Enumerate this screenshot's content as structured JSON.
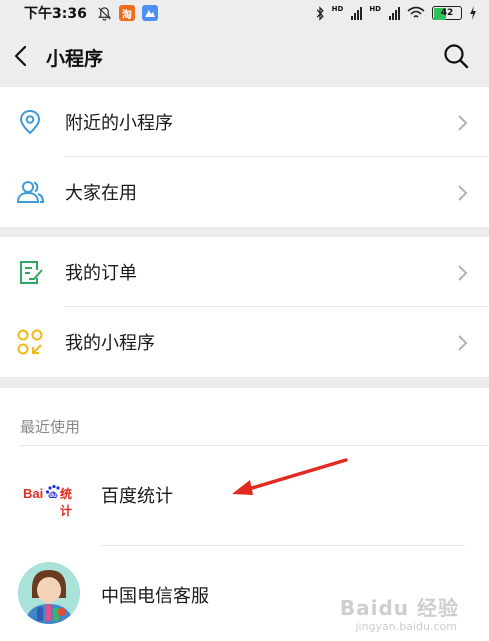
{
  "status_bar": {
    "time": "下午3:36",
    "signal_label_1": "HD",
    "signal_label_2": "HD",
    "battery_level": "42"
  },
  "nav": {
    "title": "小程序",
    "back_icon": "chevron-left-icon",
    "search_icon": "search-icon"
  },
  "menu_groups": [
    {
      "items": [
        {
          "label": "附近的小程序",
          "icon": "location-pin-icon"
        },
        {
          "label": "大家在用",
          "icon": "users-icon"
        }
      ]
    },
    {
      "items": [
        {
          "label": "我的订单",
          "icon": "order-list-icon"
        },
        {
          "label": "我的小程序",
          "icon": "my-apps-icon"
        }
      ]
    }
  ],
  "recent": {
    "title": "最近使用",
    "apps": [
      {
        "name": "百度统计",
        "logo_text": "统计"
      },
      {
        "name": "中国电信客服"
      }
    ]
  },
  "colors": {
    "accent_green": "#07c160",
    "icon_blue": "#3e9bd8",
    "icon_yellow": "#f4b916",
    "baidu_red": "#e02a22",
    "baidu_blue": "#2932e1",
    "arrow_red": "#e32a20"
  },
  "watermark": {
    "text": "Baidu 经验",
    "sub": "jingyan.baidu.com"
  }
}
